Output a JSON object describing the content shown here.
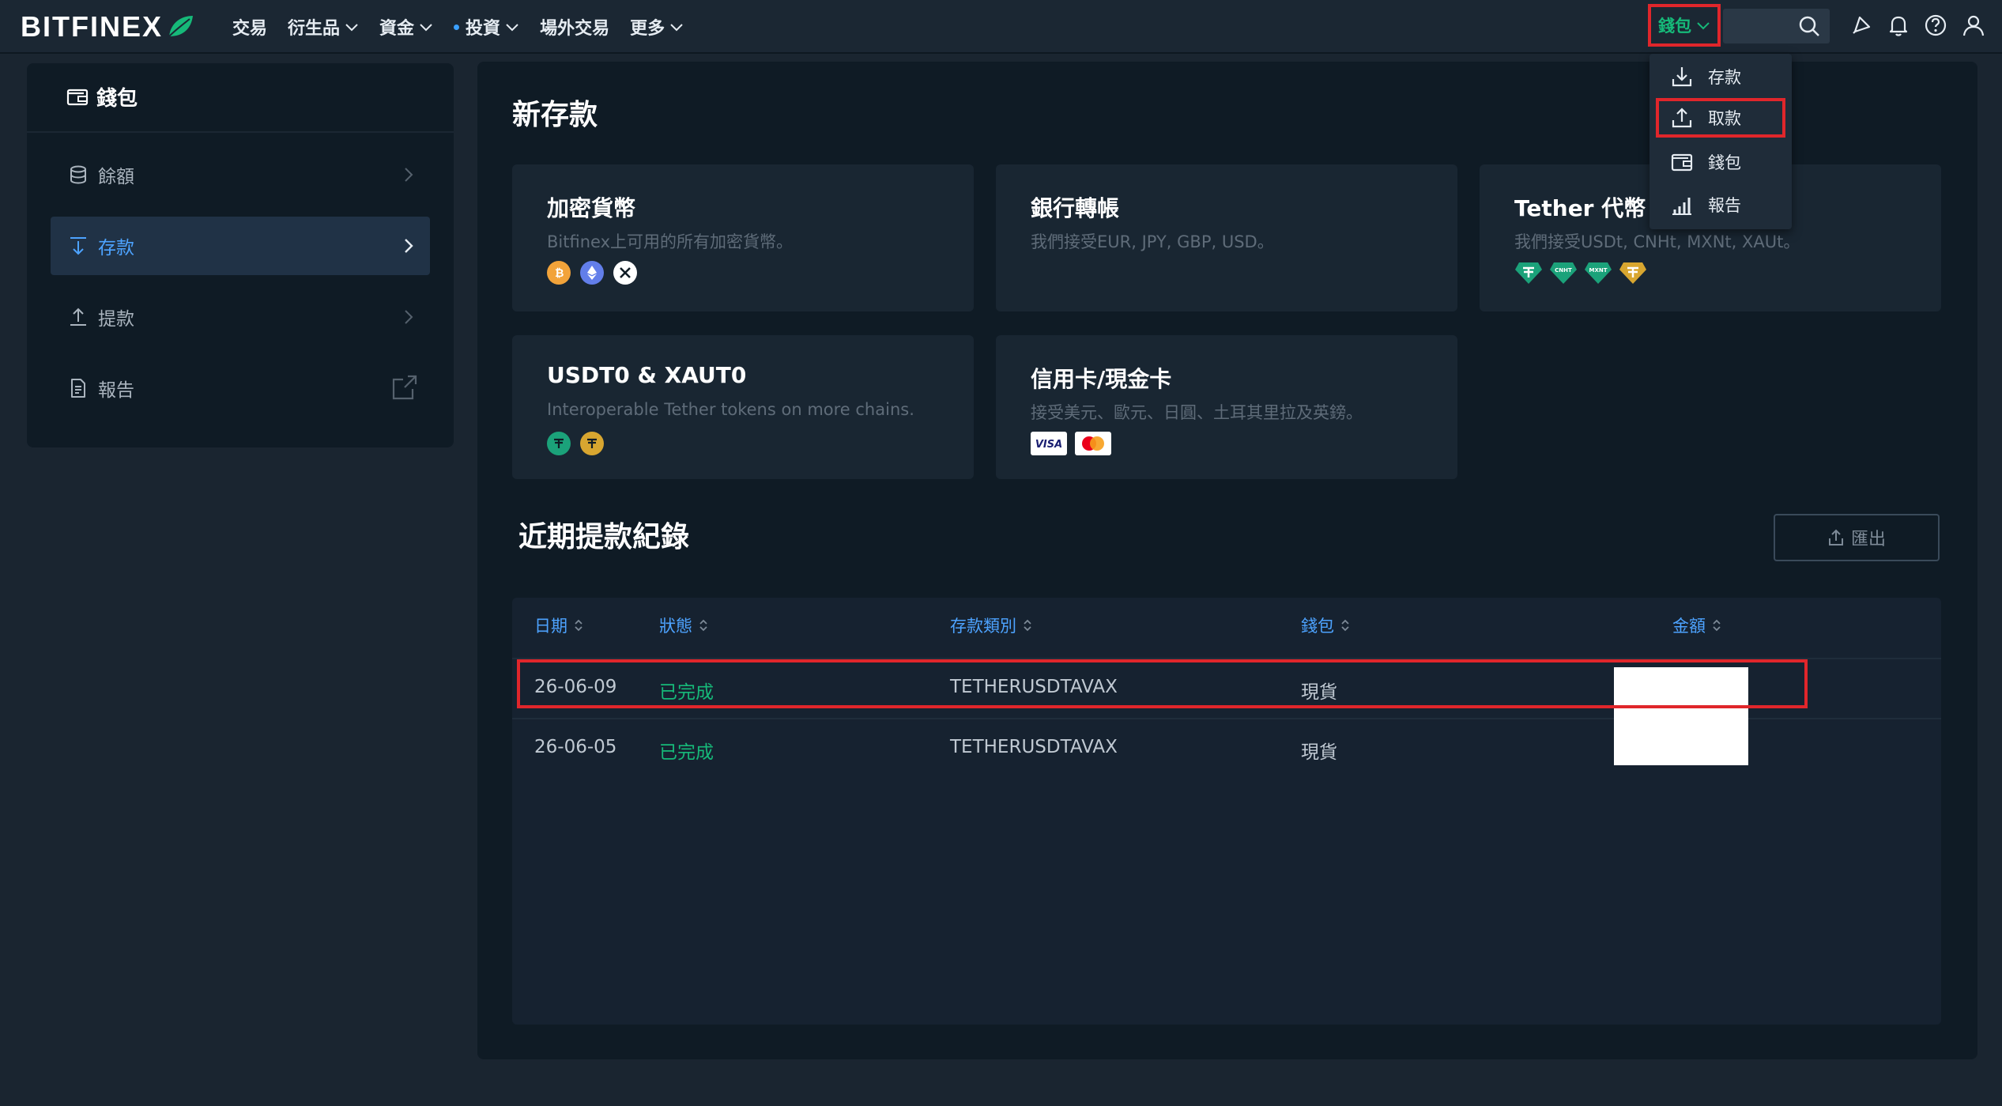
{
  "topnav": {
    "logo_text": "BITFINEX",
    "items": [
      {
        "label": "交易",
        "has_chevron": false,
        "has_dot": false
      },
      {
        "label": "衍生品",
        "has_chevron": true,
        "has_dot": false
      },
      {
        "label": "資金",
        "has_chevron": true,
        "has_dot": false
      },
      {
        "label": "投資",
        "has_chevron": true,
        "has_dot": true
      },
      {
        "label": "場外交易",
        "has_chevron": false,
        "has_dot": false
      },
      {
        "label": "更多",
        "has_chevron": true,
        "has_dot": false
      }
    ],
    "wallet_label": "錢包",
    "icons": [
      "search-icon",
      "rocket-icon",
      "bell-icon",
      "help-icon",
      "user-icon"
    ]
  },
  "wallet_menu": {
    "items": [
      {
        "label": "存款",
        "icon": "download-icon"
      },
      {
        "label": "取款",
        "icon": "upload-icon",
        "highlighted": true
      },
      {
        "label": "錢包",
        "icon": "wallet-icon"
      },
      {
        "label": "報告",
        "icon": "chart-icon"
      }
    ]
  },
  "sidebar": {
    "title": "錢包",
    "items": [
      {
        "label": "餘額",
        "icon": "database-icon",
        "active": false
      },
      {
        "label": "存款",
        "icon": "arrow-down-icon",
        "active": true
      },
      {
        "label": "提款",
        "icon": "arrow-up-icon",
        "active": false
      },
      {
        "label": "報告",
        "icon": "document-icon",
        "active": false,
        "external": true
      }
    ]
  },
  "main": {
    "title": "新存款",
    "cards": [
      {
        "title": "加密貨幣",
        "subtitle": "Bitfinex上可用的所有加密貨幣。",
        "icons": [
          "bitcoin-icon",
          "ethereum-icon",
          "xrp-icon"
        ]
      },
      {
        "title": "銀行轉帳",
        "subtitle": "我們接受EUR, JPY, GBP, USD。",
        "icons": []
      },
      {
        "title": "Tether 代幣",
        "subtitle": "我們接受USDt, CNHt, MXNt, XAUt。",
        "icons": [
          "usdt-icon",
          "cnht-icon",
          "mxnt-icon",
          "xaut-icon"
        ]
      },
      {
        "title": "USDT0 & XAUT0",
        "subtitle": "Interoperable Tether tokens on more chains.",
        "icons": [
          "usdt0-icon",
          "xaut0-icon"
        ]
      },
      {
        "title": "信用卡/現金卡",
        "subtitle": "接受美元、歐元、日圓、土耳其里拉及英鎊。",
        "icons": [
          "visa-icon",
          "mastercard-icon"
        ]
      }
    ],
    "gem_labels": {
      "cnht": "CNHT",
      "mxnt": "MXNT",
      "visa": "VISA"
    },
    "history_title": "近期提款紀錄",
    "export_label": "匯出",
    "table": {
      "headers": [
        "日期",
        "狀態",
        "存款類別",
        "錢包",
        "金額"
      ],
      "rows": [
        {
          "date": "26-06-09",
          "status": "已完成",
          "type": "TETHERUSDTAVAX",
          "wallet": "現貨",
          "amount": "",
          "highlighted": true
        },
        {
          "date": "26-06-05",
          "status": "已完成",
          "type": "TETHERUSDTAVAX",
          "wallet": "現貨",
          "amount": ""
        }
      ]
    }
  },
  "colors": {
    "accent_green": "#16b979",
    "accent_blue": "#4da3ff",
    "highlight_red": "#e0262b",
    "bitcoin": "#f2a33a",
    "ethereum": "#627eea",
    "tether": "#1ba27a",
    "gold": "#d8a630"
  }
}
